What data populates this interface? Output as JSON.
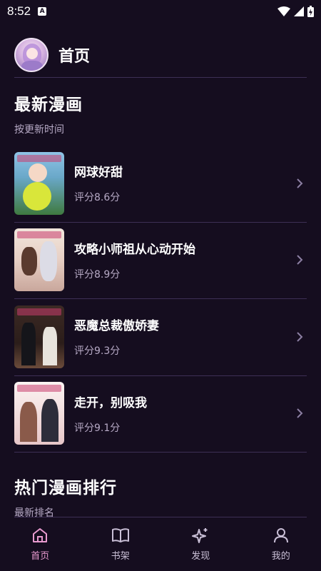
{
  "status": {
    "time": "8:52",
    "notif_letter": "A"
  },
  "header": {
    "title": "首页"
  },
  "latest": {
    "title": "最新漫画",
    "subtitle": "按更新时间",
    "items": [
      {
        "title": "网球好甜",
        "score": "评分8.6分"
      },
      {
        "title": "攻略小师祖从心动开始",
        "score": "评分8.9分"
      },
      {
        "title": "恶魔总裁傲娇妻",
        "score": "评分9.3分"
      },
      {
        "title": "走开，别吸我",
        "score": "评分9.1分"
      }
    ]
  },
  "hot": {
    "title": "热门漫画排行",
    "subtitle": "最新排名"
  },
  "tabs": [
    {
      "label": "首页",
      "icon": "home-icon",
      "active": true
    },
    {
      "label": "书架",
      "icon": "book-icon",
      "active": false
    },
    {
      "label": "发现",
      "icon": "sparkle-icon",
      "active": false
    },
    {
      "label": "我的",
      "icon": "user-icon",
      "active": false
    }
  ],
  "colors": {
    "background": "#150d1f",
    "accent": "#e99bd0",
    "divider": "#3d2f55",
    "muted": "#b7aac6"
  }
}
